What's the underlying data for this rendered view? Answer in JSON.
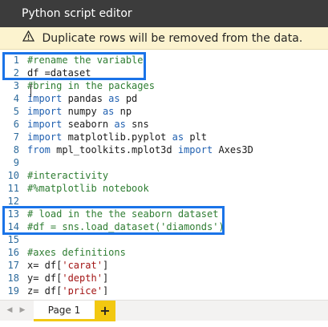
{
  "window": {
    "title": "Python script editor"
  },
  "warning": {
    "icon": "warning-icon",
    "text": "Duplicate rows will be removed from the data."
  },
  "code": {
    "lines": [
      {
        "num": "1",
        "tokens": [
          {
            "t": "comment",
            "v": "#rename the variable"
          }
        ]
      },
      {
        "num": "2",
        "tokens": [
          {
            "t": "plain",
            "v": "df =dataset"
          }
        ]
      },
      {
        "num": "3",
        "tokens": [
          {
            "t": "comment",
            "v": "#bring in the packages"
          }
        ]
      },
      {
        "num": "4",
        "tokens": [
          {
            "t": "kw",
            "v": "import"
          },
          {
            "t": "plain",
            "v": " pandas "
          },
          {
            "t": "kw",
            "v": "as"
          },
          {
            "t": "plain",
            "v": " pd"
          }
        ]
      },
      {
        "num": "5",
        "tokens": [
          {
            "t": "kw",
            "v": "import"
          },
          {
            "t": "plain",
            "v": " numpy "
          },
          {
            "t": "kw",
            "v": "as"
          },
          {
            "t": "plain",
            "v": " np"
          }
        ]
      },
      {
        "num": "6",
        "tokens": [
          {
            "t": "kw",
            "v": "import"
          },
          {
            "t": "plain",
            "v": " seaborn "
          },
          {
            "t": "kw",
            "v": "as"
          },
          {
            "t": "plain",
            "v": " sns"
          }
        ]
      },
      {
        "num": "7",
        "tokens": [
          {
            "t": "kw",
            "v": "import"
          },
          {
            "t": "plain",
            "v": " matplotlib.pyplot "
          },
          {
            "t": "kw",
            "v": "as"
          },
          {
            "t": "plain",
            "v": " plt"
          }
        ]
      },
      {
        "num": "8",
        "tokens": [
          {
            "t": "kw",
            "v": "from"
          },
          {
            "t": "plain",
            "v": " mpl_toolkits.mplot3d "
          },
          {
            "t": "kw",
            "v": "import"
          },
          {
            "t": "plain",
            "v": " Axes3D"
          }
        ]
      },
      {
        "num": "9",
        "tokens": []
      },
      {
        "num": "10",
        "tokens": [
          {
            "t": "comment",
            "v": "#interactivity"
          }
        ]
      },
      {
        "num": "11",
        "tokens": [
          {
            "t": "comment",
            "v": "#%matplotlib notebook"
          }
        ]
      },
      {
        "num": "12",
        "tokens": []
      },
      {
        "num": "13",
        "tokens": [
          {
            "t": "comment",
            "v": "# load in the the seaborn dataset"
          }
        ]
      },
      {
        "num": "14",
        "tokens": [
          {
            "t": "comment",
            "v": "#df = sns.load_dataset('diamonds')"
          }
        ]
      },
      {
        "num": "15",
        "tokens": []
      },
      {
        "num": "16",
        "tokens": [
          {
            "t": "comment",
            "v": "#axes definitions"
          }
        ]
      },
      {
        "num": "17",
        "tokens": [
          {
            "t": "plain",
            "v": "x= df["
          },
          {
            "t": "str",
            "v": "'carat'"
          },
          {
            "t": "plain",
            "v": "]"
          }
        ]
      },
      {
        "num": "18",
        "tokens": [
          {
            "t": "plain",
            "v": "y= df["
          },
          {
            "t": "str",
            "v": "'depth'"
          },
          {
            "t": "plain",
            "v": "]"
          }
        ]
      },
      {
        "num": "19",
        "tokens": [
          {
            "t": "plain",
            "v": "z= df["
          },
          {
            "t": "str",
            "v": "'price'"
          },
          {
            "t": "plain",
            "v": "]"
          }
        ]
      }
    ]
  },
  "tabs": {
    "prev_icon": "chevron-left-icon",
    "next_icon": "chevron-right-icon",
    "pages": [
      {
        "label": "Page 1"
      }
    ],
    "add_label": "+"
  },
  "colors": {
    "accent": "#f2c811",
    "highlight": "#1a73e8",
    "titlebar": "#3c3c3c",
    "warning_bg": "#fcf3cf"
  }
}
